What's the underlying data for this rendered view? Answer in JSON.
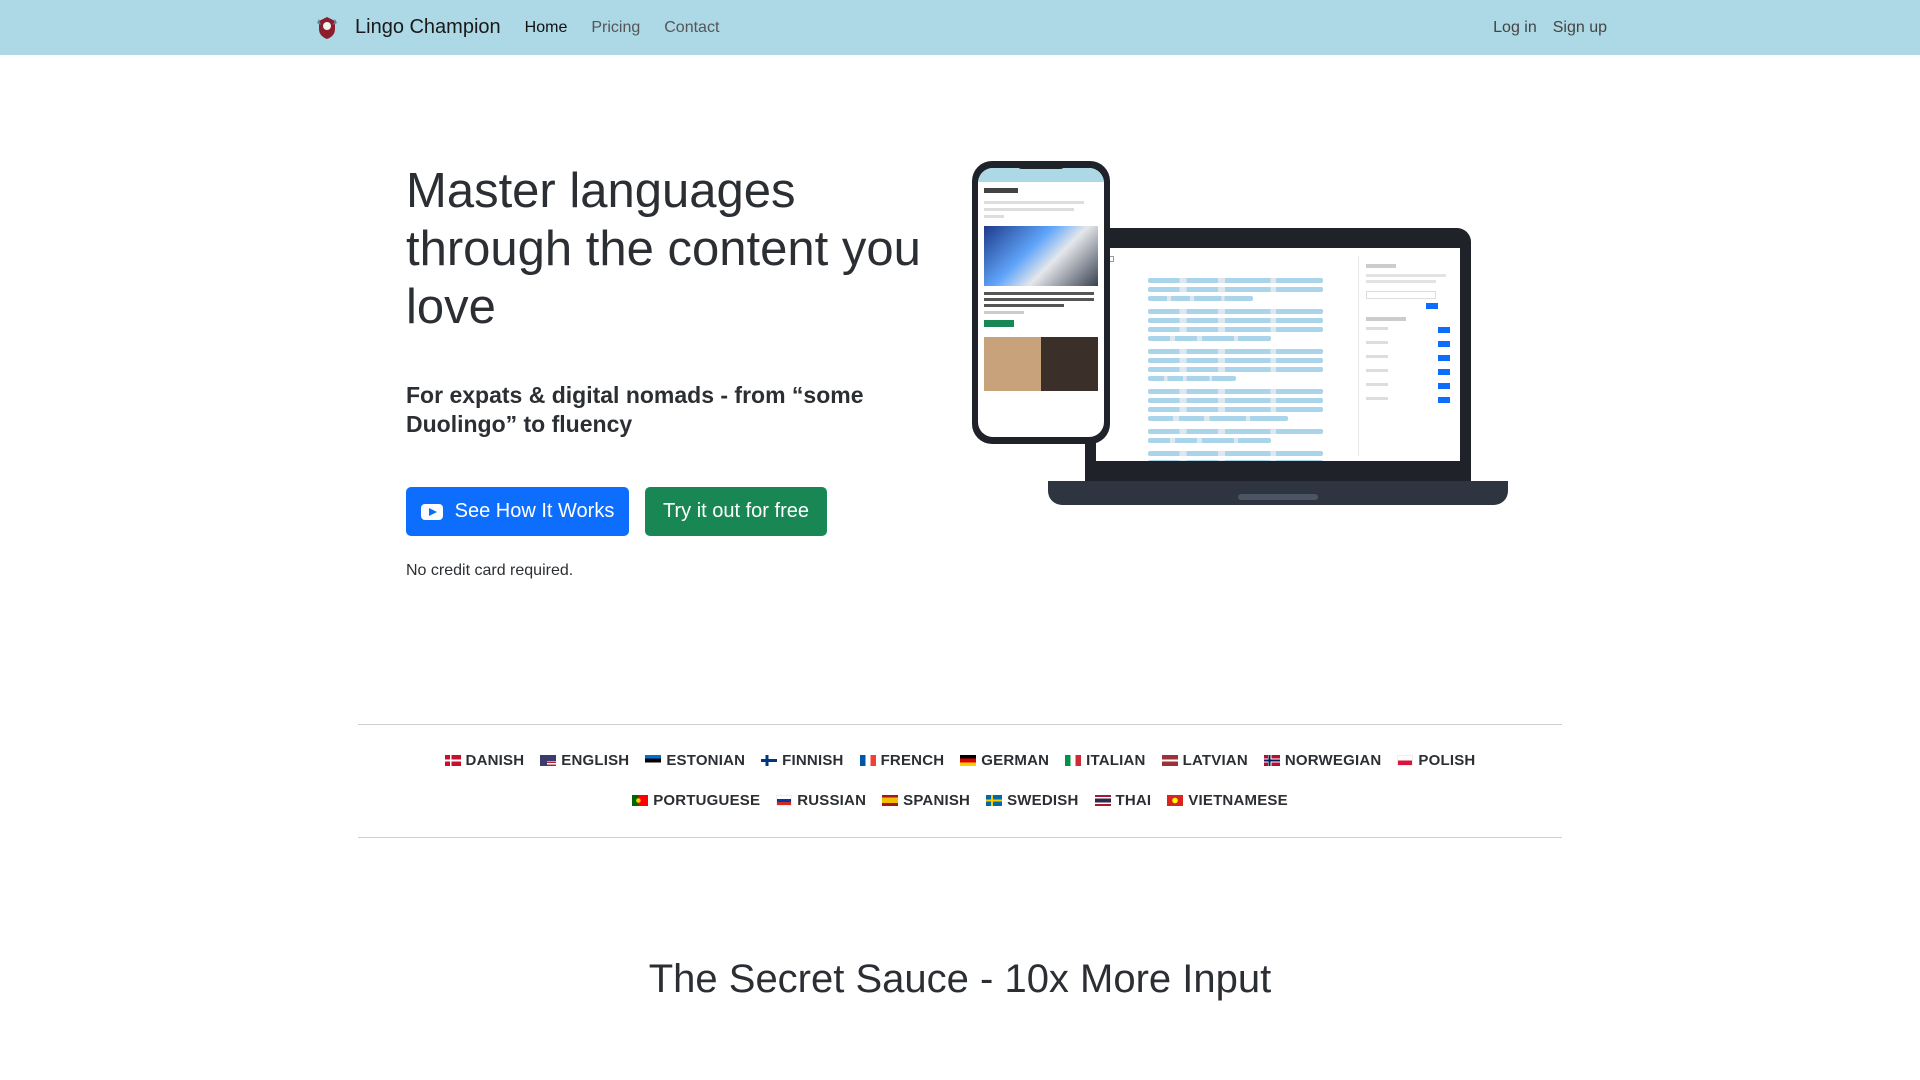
{
  "nav": {
    "brand": "Lingo Champion",
    "links": [
      "Home",
      "Pricing",
      "Contact"
    ],
    "login": "Log in",
    "signup": "Sign up"
  },
  "hero": {
    "title": "Master languages through the content you love",
    "subtitle": "For expats & digital nomads - from “some Duolingo” to fluency",
    "cta_primary": "See How It Works",
    "cta_secondary": "Try it out for free",
    "note": "No credit card required."
  },
  "languages_row1": [
    "DANISH",
    "ENGLISH",
    "ESTONIAN",
    "FINNISH",
    "FRENCH",
    "GERMAN",
    "ITALIAN",
    "LATVIAN",
    "NORWEGIAN",
    "POLISH"
  ],
  "languages_row2": [
    "PORTUGUESE",
    "RUSSIAN",
    "SPANISH",
    "SWEDISH",
    "THAI",
    "VIETNAMESE"
  ],
  "section_title": "The Secret Sauce - 10x More Input",
  "colors": {
    "navbar": "#add8e6",
    "primary": "#0d6efd",
    "success": "#198754"
  }
}
